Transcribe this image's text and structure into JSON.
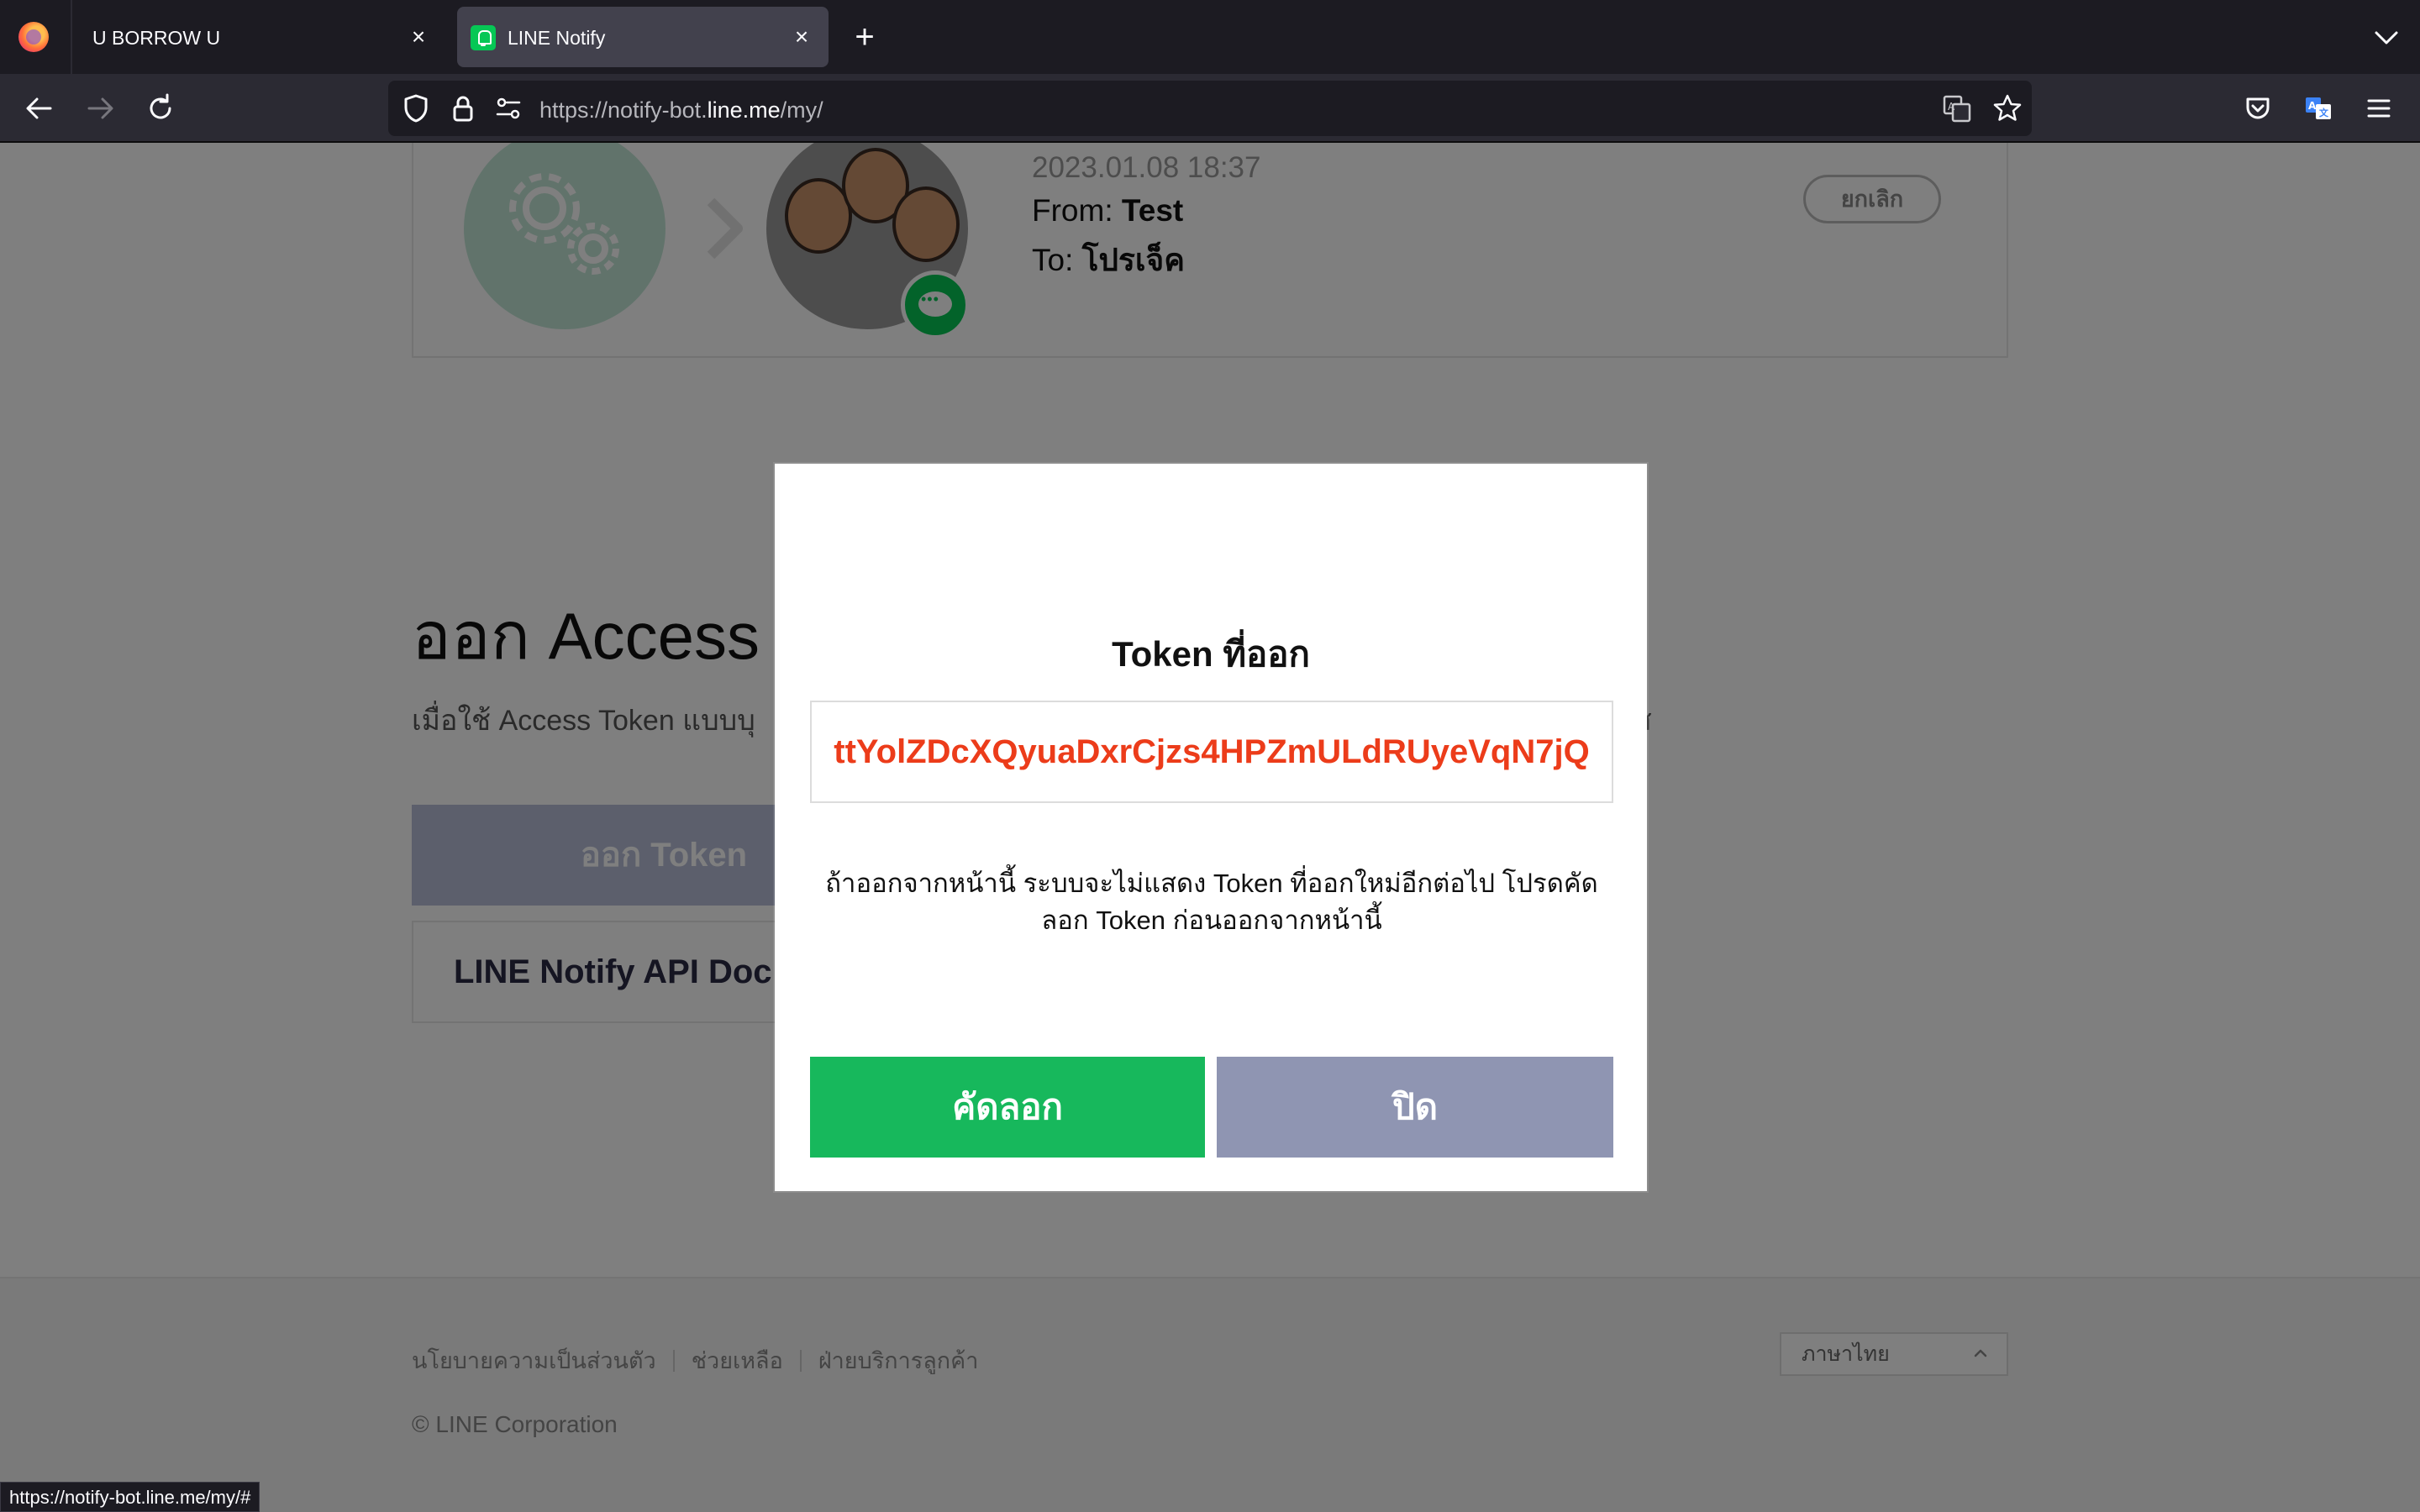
{
  "browser": {
    "tabs": [
      {
        "title": "U BORROW U",
        "active": false
      },
      {
        "title": "LINE Notify",
        "active": true
      }
    ],
    "url": {
      "prefix": "https://notify-bot.",
      "domain": "line.me",
      "suffix": "/my/"
    },
    "status_url": "https://notify-bot.line.me/my/#"
  },
  "connection_card": {
    "date": "2023.01.08 18:37",
    "from_label": "From:",
    "from_value": "Test",
    "to_label": "To:",
    "to_value": "โปรเจ็ค",
    "cancel_label": "ยกเลิก"
  },
  "section": {
    "title": "ออก Access T",
    "description": "เมื่อใช้ Access Token แบบบุ",
    "description_end": "ส",
    "issue_button": "ออก Token",
    "docs_link": "LINE Notify API Doc"
  },
  "modal": {
    "title": "Token ที่ออก",
    "token": "ttYolZDcXQyuaDxrCjzs4HPZmULdRUyeVqN7jQ",
    "message": "ถ้าออกจากหน้านี้ ระบบจะไม่แสดง Token ที่ออกใหม่อีกต่อไป โปรดคัดลอก Token ก่อนออกจากหน้านี้",
    "copy_label": "คัดลอก",
    "close_label": "ปิด"
  },
  "footer": {
    "links": [
      "นโยบายความเป็นส่วนตัว",
      "ช่วยเหลือ",
      "ฝ่ายบริการลูกค้า"
    ],
    "language": "ภาษาไทย",
    "copyright": "© LINE Corporation"
  },
  "colors": {
    "accent_green": "#17b85c",
    "token_red": "#ec3c1a",
    "close_button": "#8f95b2"
  }
}
